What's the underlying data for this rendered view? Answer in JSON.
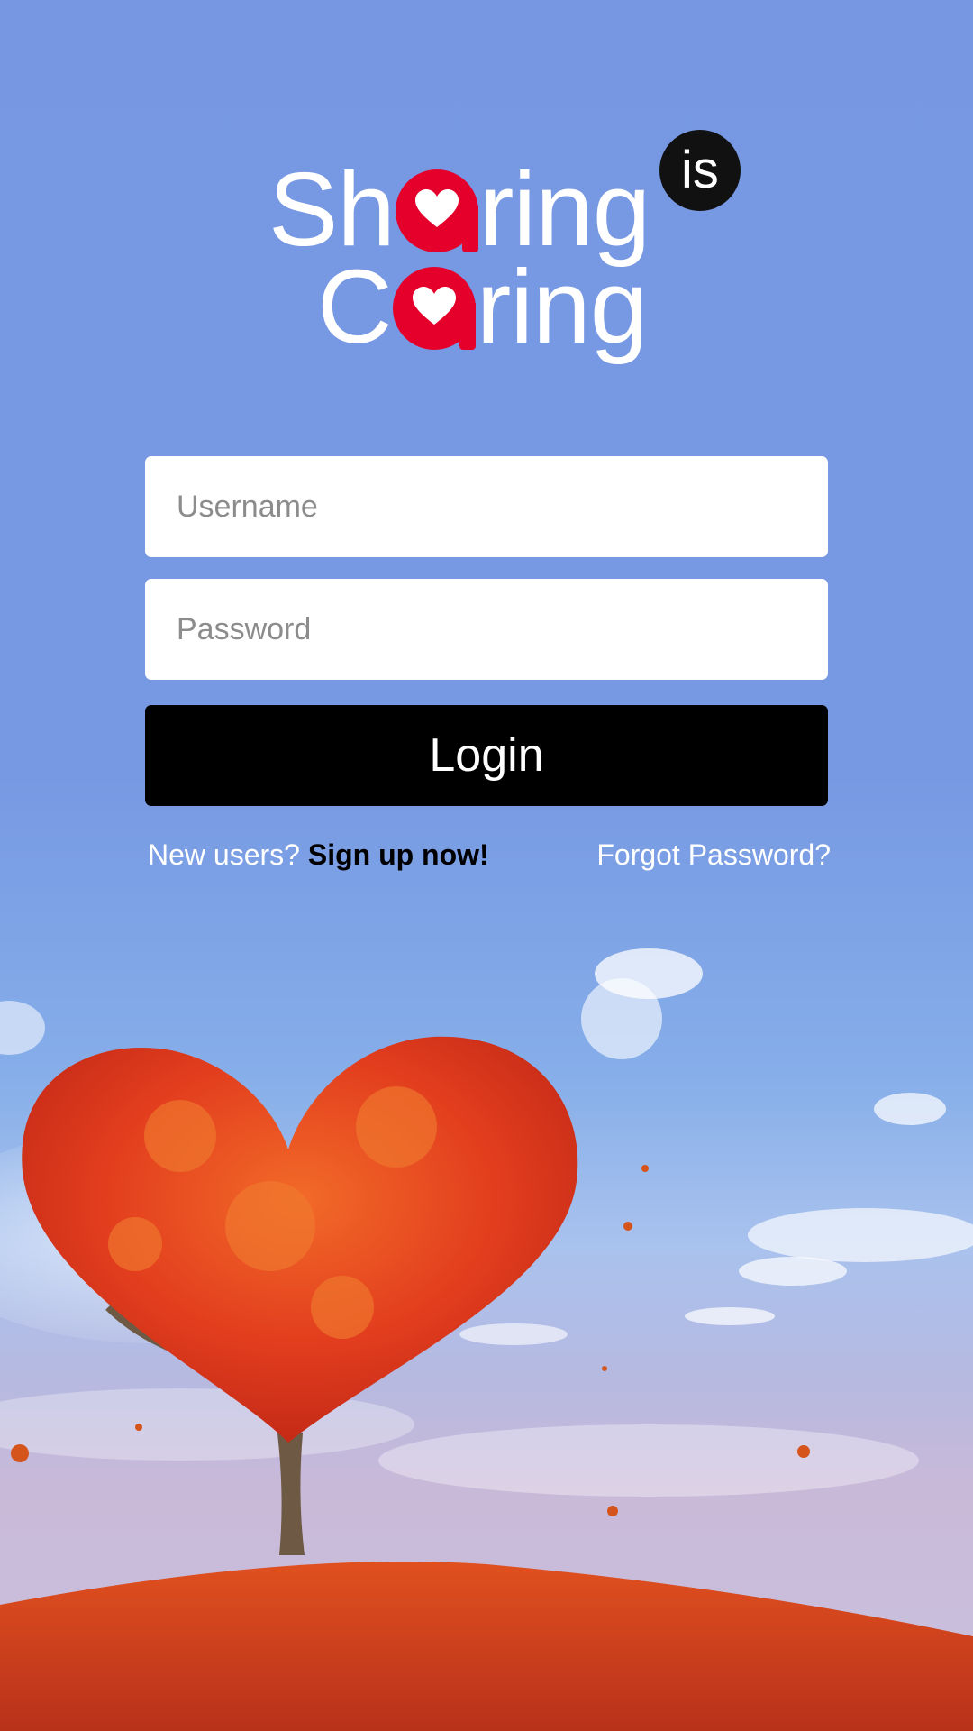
{
  "logo": {
    "line1_start": "Sh",
    "line1_end": "ring",
    "line2_start": "C",
    "line2_end": "ring",
    "badge": "is",
    "brand_red": "#e4002b"
  },
  "login_form": {
    "username_placeholder": "Username",
    "password_placeholder": "Password",
    "login_label": "Login"
  },
  "links": {
    "new_users_text": "New users? ",
    "signup_label": "Sign up now!",
    "forgot_label": "Forgot Password?"
  },
  "icons": [
    "heart-icon"
  ],
  "colors": {
    "sky": "#7797e2",
    "button": "#000000",
    "tree_red": "#e23d1e",
    "ground": "#d8421c"
  }
}
